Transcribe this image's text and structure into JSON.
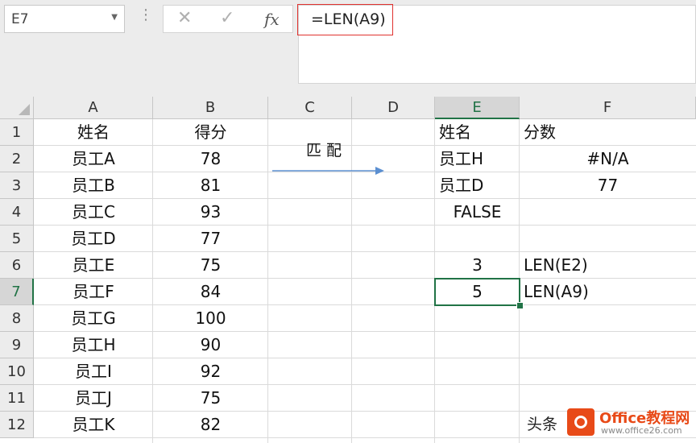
{
  "formula_bar": {
    "name_box": "E7",
    "cancel_icon": "✕",
    "enter_icon": "✓",
    "fx_label": "fx",
    "formula": "=LEN(A9)"
  },
  "columns": [
    "A",
    "B",
    "C",
    "D",
    "E",
    "F"
  ],
  "rows": [
    "1",
    "2",
    "3",
    "4",
    "5",
    "6",
    "7",
    "8",
    "9",
    "10",
    "11",
    "12"
  ],
  "cells": {
    "A": [
      "姓名",
      "员工A",
      "员工B",
      "员工C",
      "员工D",
      "员工E",
      "员工F",
      "员工G",
      "员工H",
      "员工I",
      "员工J",
      "员工K"
    ],
    "B": [
      "得分",
      "78",
      "81",
      "93",
      "77",
      "75",
      "84",
      "100",
      "90",
      "92",
      "75",
      "82"
    ],
    "E": [
      "姓名",
      "员工H",
      "员工D",
      "FALSE",
      "",
      "3",
      "5",
      "",
      "",
      "",
      "",
      ""
    ],
    "F": [
      "分数",
      "#N/A",
      "77",
      "",
      "",
      "LEN(E2)",
      "LEN(A9)",
      "",
      "",
      "",
      "",
      ""
    ]
  },
  "annotation": "匹配",
  "selected_cell": "E7",
  "watermark": {
    "left_text": "头条",
    "title": "Office教程网",
    "url": "www.office26.com"
  },
  "colors": {
    "accent": "#217346",
    "highlight_border": "#e0322f",
    "arrow": "#5b8fd1"
  }
}
